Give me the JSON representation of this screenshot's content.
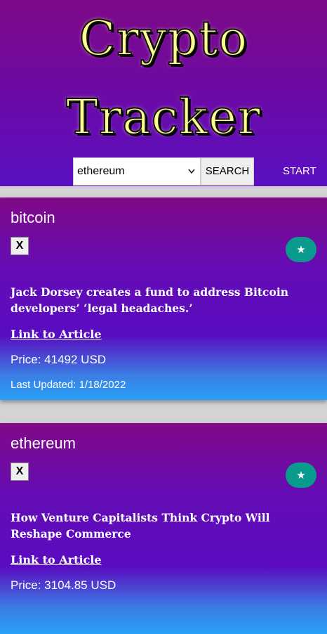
{
  "header": {
    "title_line1": "Crypto",
    "title_line2": "Tracker",
    "select_value": "ethereum",
    "search_label": "SEARCH",
    "start_label": "START"
  },
  "cards": [
    {
      "name": "bitcoin",
      "remove_label": "X",
      "favorite_icon": "★",
      "headline": "Jack Dorsey creates a fund to address Bitcoin developers’ ‘legal headaches.’",
      "link_label": "Link to Article",
      "price": "Price: 41492 USD",
      "updated": "Last Updated: 1/18/2022"
    },
    {
      "name": "ethereum",
      "remove_label": "X",
      "favorite_icon": "★",
      "headline": "How Venture Capitalists Think Crypto Will Reshape Commerce",
      "link_label": "Link to Article",
      "price": "Price: 3104.85 USD"
    }
  ],
  "colors": {
    "header_top": "#7d0a86",
    "header_bottom": "#5a10c2",
    "card_accent": "#2aa0f8",
    "favorite_button": "#0a9a8e",
    "title_text": "#ffff8f"
  }
}
